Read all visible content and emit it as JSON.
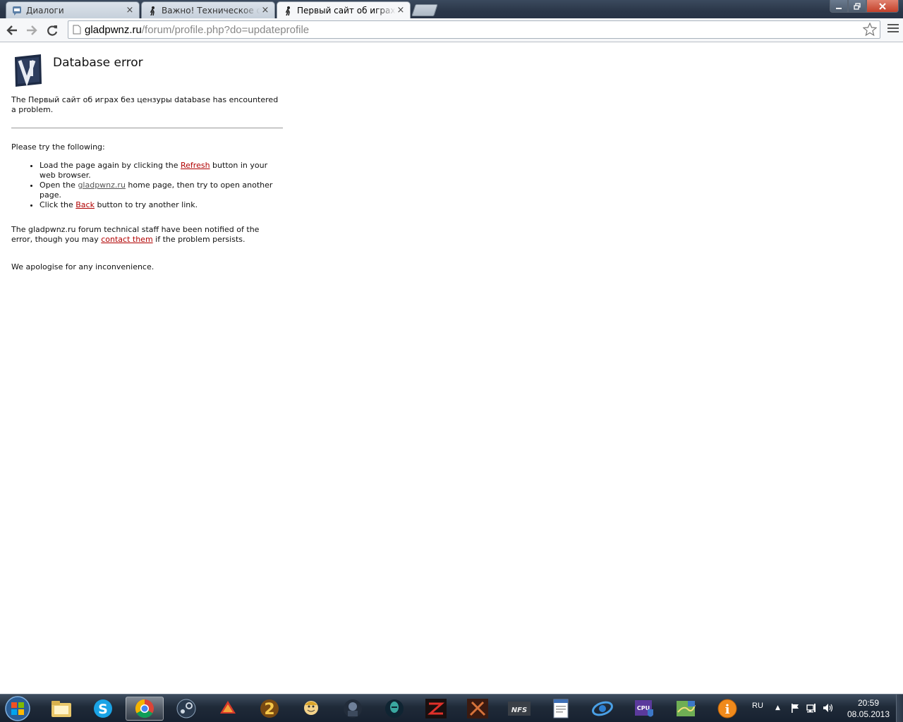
{
  "browser": {
    "tabs": [
      {
        "label": "Диалоги",
        "favicon": "vk-icon",
        "active": false
      },
      {
        "label": "Важно! Техническое обслуживание",
        "favicon": "site-man-icon",
        "active": false
      },
      {
        "label": "Первый сайт об играх без цензуры",
        "favicon": "site-man-icon",
        "active": true
      }
    ],
    "address": {
      "host": "gladpwnz.ru",
      "path": "/forum/profile.php?do=updateprofile"
    }
  },
  "page": {
    "title": "Database error",
    "intro": "The Первый сайт об играх без цензуры database has encountered a problem.",
    "try_heading": "Please try the following:",
    "items": {
      "i1_before": "Load the page again by clicking the ",
      "i1_link": "Refresh",
      "i1_after": " button in your web browser.",
      "i2_before": "Open the ",
      "i2_link": "gladpwnz.ru",
      "i2_after": " home page, then try to open another page.",
      "i3_before": "Click the ",
      "i3_link": "Back",
      "i3_after": " button to try another link."
    },
    "staff_before": "The gladpwnz.ru forum technical staff have been notified of the error, though you may ",
    "staff_link": "contact them",
    "staff_after": " if the problem persists.",
    "apology": "We apologise for any inconvenience."
  },
  "taskbar": {
    "apps": [
      "windows-explorer",
      "skype",
      "google-chrome",
      "steam",
      "game-launcher-red",
      "game-2-gold",
      "fallout-vault-boy",
      "game-soldier",
      "game-alien",
      "game-red-logo",
      "game-dota-logo",
      "nfs",
      "notepad-document",
      "browser-wing",
      "cpu-z-shield",
      "map-game",
      "info-circle"
    ],
    "active_app": "google-chrome",
    "language": "RU",
    "time": "20:59",
    "date": "08.05.2013"
  },
  "colors": {
    "link": "#b00000",
    "link_visited": "#555555",
    "taskbar": "#1f2a38"
  }
}
